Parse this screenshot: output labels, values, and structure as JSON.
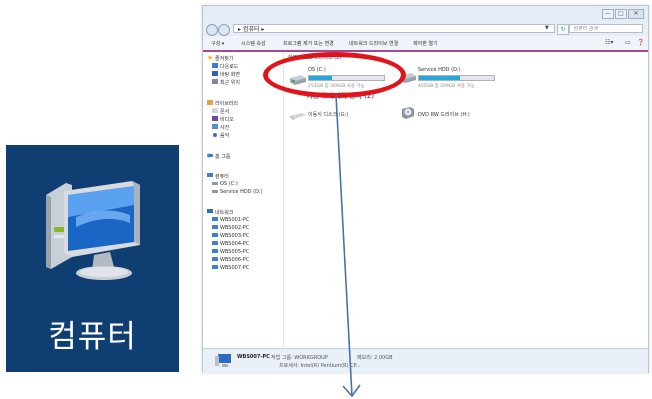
{
  "tile": {
    "label": "컴퓨터",
    "icon": "computer-icon"
  },
  "window": {
    "caption": {
      "minimize": "—",
      "maximize": "□",
      "close": "✕"
    },
    "address": {
      "path": "▸ 컴퓨터 ▸",
      "search_placeholder": "컴퓨터 검색"
    },
    "toolbar": {
      "items": [
        "구성 ▾",
        "시스템 속성",
        "프로그램 제거 또는 변경",
        "네트워크 드라이브 연결",
        "제어판 열기"
      ]
    },
    "sidebar": {
      "favorites": {
        "title": "즐겨찾기",
        "items": [
          "다운로드",
          "바탕 화면",
          "최근 위치"
        ]
      },
      "libraries": {
        "title": "라이브러리",
        "items": [
          "문서",
          "비디오",
          "사진",
          "음악"
        ]
      },
      "homegroup": "홈 그룹",
      "computer": {
        "title": "컴퓨터",
        "items": [
          "OS (C:)",
          "Service HDD (D:)"
        ]
      },
      "network": {
        "title": "네트워크",
        "items": [
          "WBS001-PC",
          "WBS002-PC",
          "WBS003-PC",
          "WBS004-PC",
          "WBS005-PC",
          "WBS006-PC",
          "WBS007-PC"
        ]
      }
    },
    "content": {
      "hdd_group": "하드 디스크 드라이브 (2)",
      "drives": [
        {
          "name": "OS (C:)",
          "detail": "253GB 중 349GB 사용 가능",
          "used_fraction": 0.3
        },
        {
          "name": "Service HDD (D:)",
          "detail": "465GB 중 209GB 사용 가능",
          "used_fraction": 0.55
        }
      ],
      "removable_group": "이동식 미디어 장치 (2)",
      "removable": [
        {
          "name": "이동식 디스크 (G:)"
        },
        {
          "name": "DVD RW 드라이브 (H:)"
        }
      ]
    },
    "status": {
      "pc_name": "WBS007-PC",
      "workgroup": "작업 그룹: WORKGROUP",
      "memory": "메모리: 2.00GB",
      "processor": "프로세서: Intel(R) Pentium(R) CP..."
    }
  },
  "colors": {
    "tile_bg": "#0f3f72",
    "highlight": "#e2141b",
    "arrow": "#4a72a8",
    "toolbar_accent": "#a04a96",
    "usage_bar": "#27a8d8"
  }
}
